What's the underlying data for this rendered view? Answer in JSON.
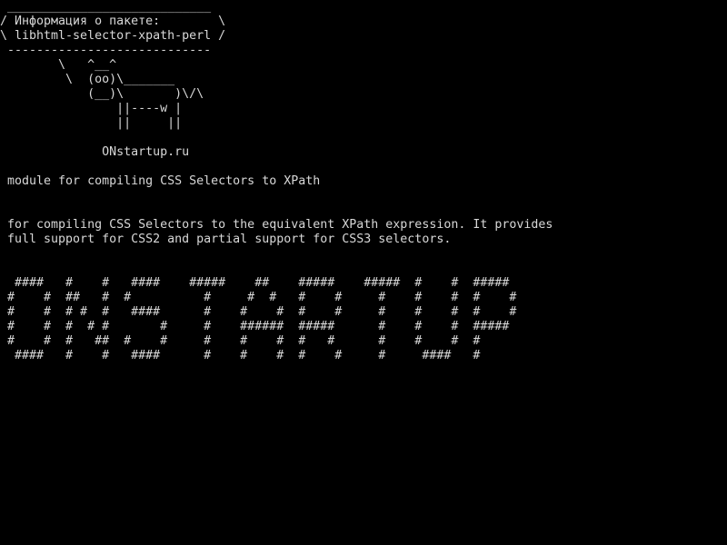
{
  "terminal": {
    "speech_bubble": " ____________________________\n/ Информация о пакете:        \\\n\\ libhtml-selector-xpath-perl /\n ----------------------------",
    "cow_art": "        \\   ^__^\n         \\  (oo)\\_______\n            (__)\\       )\\/\\\n                ||----w |\n                ||     ||",
    "site": "              ONstartup.ru",
    "summary": " module for compiling CSS Selectors to XPath",
    "description": " for compiling CSS Selectors to the equivalent XPath expression. It provides\n full support for CSS2 and partial support for CSS3 selectors.",
    "banner": "  ####   #    #   ####    #####    ##    #####    #####  #    #  #####\n #    #  ##   #  #          #     #  #   #    #     #    #    #  #    #\n #    #  # #  #   ####      #    #    #  #    #     #    #    #  #    #\n #    #  #  # #       #     #    ######  #####      #    #    #  #####\n #    #  #   ##  #    #     #    #    #  #   #      #    #    #  #\n  ####   #    #   ####      #    #    #  #    #     #     ####   #"
  }
}
